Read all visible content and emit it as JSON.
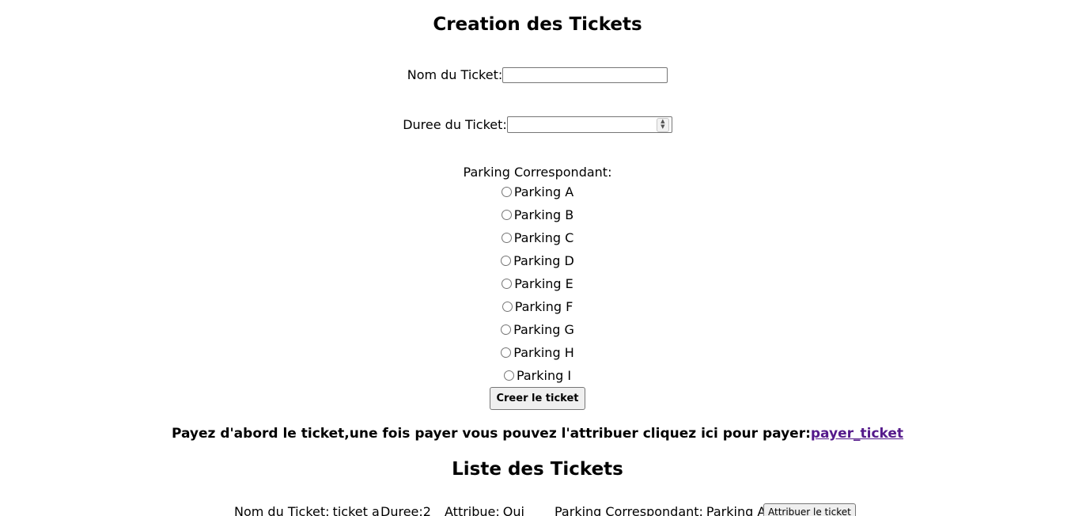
{
  "creation": {
    "title": "Creation des Tickets",
    "name_label": "Nom du Ticket:",
    "name_value": "",
    "duration_label": "Duree du Ticket:",
    "duration_value": "",
    "parking_label": "Parking Correspondant:",
    "parkings": [
      "Parking A",
      "Parking B",
      "Parking C",
      "Parking D",
      "Parking E",
      "Parking F",
      "Parking G",
      "Parking H",
      "Parking I"
    ],
    "selected_parking": null,
    "create_button": "Creer le ticket"
  },
  "notice": {
    "text": "Payez d'abord le ticket,une fois payer vous pouvez l'attribuer cliquez ici pour payer:",
    "link_text": "payer_ticket"
  },
  "list": {
    "title": "Liste des Tickets",
    "tickets": [
      {
        "name_label": "Nom du Ticket:",
        "name": "ticket a",
        "duration_label": "Duree:",
        "duration": "2",
        "assigned_label": "Attribue:",
        "assigned": "Oui",
        "parking_label": "Parking Correspondant:",
        "parking": "Parking A",
        "assign_button": "Attribuer le ticket"
      }
    ]
  },
  "colors": {
    "link_visited": "#551a8b",
    "button_bg": "#efefef",
    "border": "#767676"
  }
}
